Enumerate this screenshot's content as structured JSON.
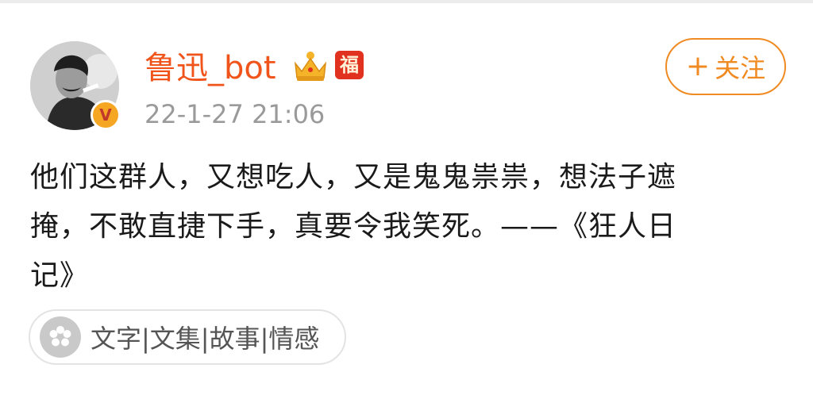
{
  "post": {
    "author": {
      "name": "鲁迅_bot",
      "verified_badge_glyph": "V",
      "badges": [
        "crown-icon",
        "fu-icon"
      ],
      "fu_glyph": "福"
    },
    "timestamp": "22-1-27 21:06",
    "follow_button": {
      "plus": "+",
      "label": "关注"
    },
    "content_lines": [
      "他们这群人，又想吃人，又是鬼鬼祟祟，想法子遮",
      "掩，不敢直捷下手，真要令我笑死。——《狂人日",
      "记》"
    ],
    "topic_chip": {
      "icon": "flower-icon",
      "label": "文字|文集|故事|情感"
    }
  },
  "colors": {
    "username": "#f0541a",
    "accent": "#f08a22",
    "timestamp": "#9a9a9a",
    "text": "#1a1a1a",
    "verify_badge": "#f5a623",
    "fu_badge": "#e0321e"
  }
}
